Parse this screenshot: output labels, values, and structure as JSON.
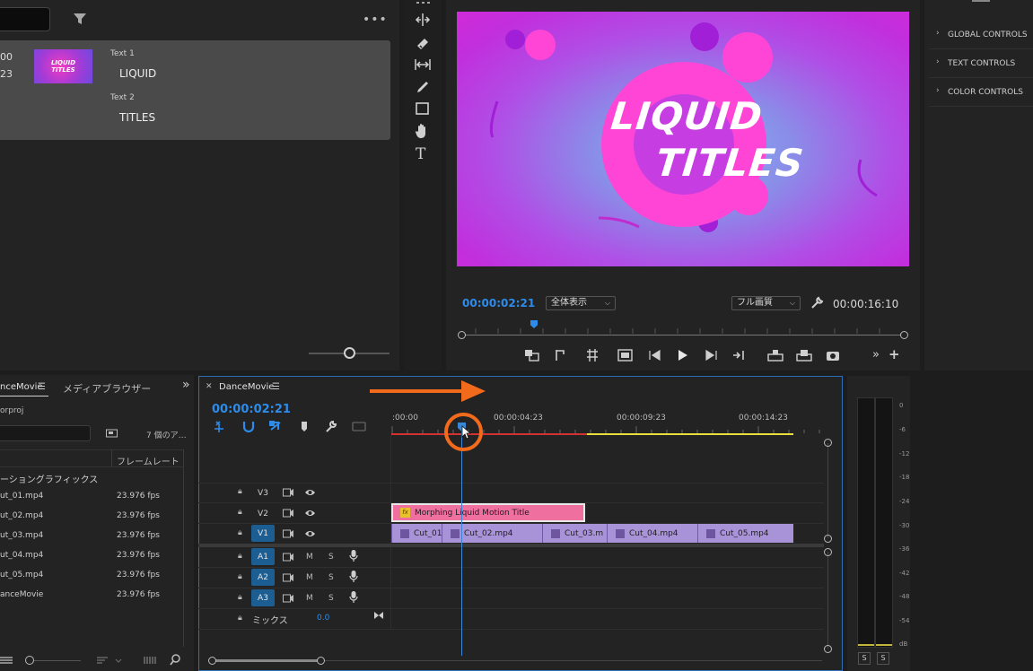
{
  "essential_graphics": {
    "timecode_fragment_1": "00",
    "timecode_fragment_2": "23",
    "text1_label": "Text 1",
    "text1_value": "LIQUID",
    "text2_label": "Text 2",
    "text2_value": "TITLES",
    "thumb_line1": "LIQUID",
    "thumb_line2": "TITLES"
  },
  "program_monitor": {
    "preview_title_line1": "LIQUID",
    "preview_title_line2": "TITLES",
    "current_time": "00:00:02:21",
    "fit_select": "全体表示",
    "quality_select": "フル画質",
    "duration": "00:00:16:10"
  },
  "controls_panel": {
    "items": [
      "GLOBAL CONTROLS",
      "TEXT CONTROLS",
      "COLOR CONTROLS"
    ]
  },
  "project_panel": {
    "tab_project": "nceMovie",
    "tab_media_browser": "メディアブラウザー",
    "project_file": "orproj",
    "item_count": "7 個のア…",
    "col_framerate": "フレームレート",
    "group_label": "ーショングラフィックス",
    "rows": [
      {
        "name": "ut_01.mp4",
        "fps": "23.976 fps"
      },
      {
        "name": "ut_02.mp4",
        "fps": "23.976 fps"
      },
      {
        "name": "ut_03.mp4",
        "fps": "23.976 fps"
      },
      {
        "name": "ut_04.mp4",
        "fps": "23.976 fps"
      },
      {
        "name": "ut_05.mp4",
        "fps": "23.976 fps"
      },
      {
        "name": "anceMovie",
        "fps": "23.976 fps"
      }
    ]
  },
  "timeline": {
    "sequence_name": "DanceMovie",
    "current_time": "00:00:02:21",
    "ruler_labels": [
      ":00:00",
      "00:00:04:23",
      "00:00:09:23",
      "00:00:14:23"
    ],
    "tracks": {
      "v3": "V3",
      "v2": "V2",
      "v1": "V1",
      "a1": "A1",
      "a2": "A2",
      "a3": "A3",
      "m": "M",
      "s": "S",
      "mix": "ミックス",
      "mix_value": "0.0"
    },
    "title_clip": "Morphing Liquid Motion Title",
    "fx_label": "fx",
    "clips": [
      "Cut_01",
      "Cut_02.mp4",
      "Cut_03.m",
      "Cut_04.mp4",
      "Cut_05.mp4"
    ]
  },
  "audio_meter": {
    "scale": [
      "0",
      "-6",
      "-12",
      "-18",
      "-24",
      "-30",
      "-36",
      "-42",
      "-48",
      "-54",
      "dB"
    ],
    "solo_left": "S",
    "solo_right": "S"
  },
  "colors": {
    "accent_blue": "#2d8ceb",
    "annotation_orange": "#f26b1d",
    "title_clip_pink": "#ef6f9e",
    "video_clip_purple": "#a892d8",
    "render_red": "#d23232",
    "render_yellow": "#e8df3a"
  }
}
